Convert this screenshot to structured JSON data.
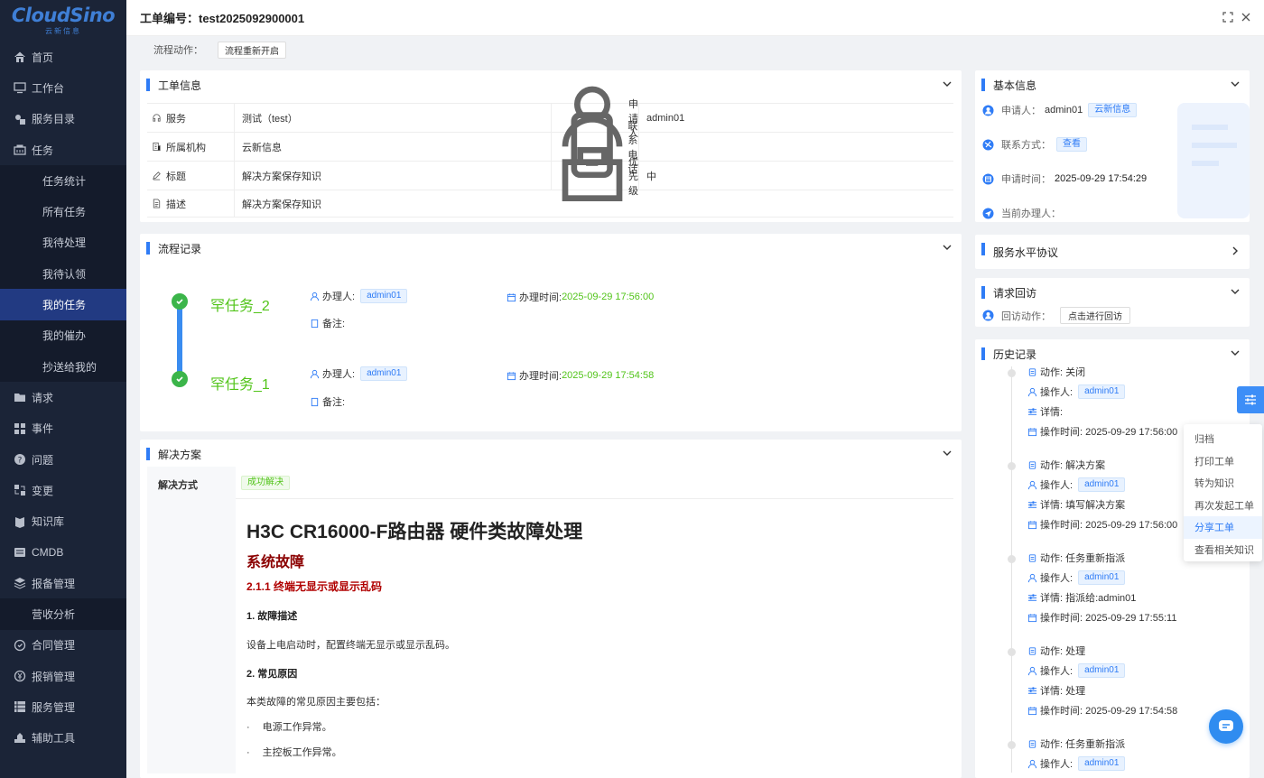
{
  "app": {
    "logo_text": "CloudSino",
    "logo_sub": "云新信息"
  },
  "sidebar": {
    "items": [
      {
        "label": "首页",
        "icon": "home-icon"
      },
      {
        "label": "工作台",
        "icon": "monitor-icon"
      },
      {
        "label": "服务目录",
        "icon": "catalog-icon"
      },
      {
        "label": "任务",
        "icon": "task-icon"
      },
      {
        "label": "任务统计",
        "sub": true
      },
      {
        "label": "所有任务",
        "sub": true
      },
      {
        "label": "我待处理",
        "sub": true
      },
      {
        "label": "我待认领",
        "sub": true
      },
      {
        "label": "我的任务",
        "sub": true,
        "active": true
      },
      {
        "label": "我的催办",
        "sub": true
      },
      {
        "label": "抄送给我的",
        "sub": true
      },
      {
        "label": "请求",
        "icon": "folder-icon"
      },
      {
        "label": "事件",
        "icon": "grid-icon"
      },
      {
        "label": "问题",
        "icon": "question-icon"
      },
      {
        "label": "变更",
        "icon": "change-icon"
      },
      {
        "label": "知识库",
        "icon": "knowledge-icon"
      },
      {
        "label": "CMDB",
        "icon": "cmdb-icon"
      },
      {
        "label": "报备管理",
        "icon": "layers-icon"
      },
      {
        "label": "营收分析",
        "sub_plain": true
      },
      {
        "label": "合同管理",
        "icon": "contract-icon"
      },
      {
        "label": "报销管理",
        "icon": "money-icon"
      },
      {
        "label": "服务管理",
        "icon": "service-icon"
      },
      {
        "label": "辅助工具",
        "icon": "tool-icon"
      }
    ]
  },
  "header": {
    "title": "工单编号：test2025092900001"
  },
  "action_bar": {
    "label": "流程动作：",
    "button": "流程重新开启"
  },
  "work_order": {
    "title": "工单信息",
    "rows": [
      {
        "label1": "服务",
        "value1": "测试（test）",
        "label2": "申请人",
        "value2": "admin01"
      },
      {
        "label1": "所属机构",
        "value1": "云新信息",
        "label2": "联系电话",
        "value2": ""
      },
      {
        "label1": "标题",
        "value1": "解决方案保存知识",
        "label2": "优先级",
        "value2": "中"
      },
      {
        "label1": "描述",
        "value1": "解决方案保存知识"
      }
    ]
  },
  "process": {
    "title": "流程记录",
    "items": [
      {
        "name": "任务_2",
        "handler_label": "办理人:",
        "handler": "admin01",
        "time_label": "办理时间:",
        "time": "2025-09-29  17:56:00",
        "note_label": "备注:"
      },
      {
        "name": "任务_1",
        "handler_label": "办理人:",
        "handler": "admin01",
        "time_label": "办理时间:",
        "time": "2025-09-29  17:54:58",
        "note_label": "备注:"
      }
    ]
  },
  "solution": {
    "title": "解决方案",
    "method_label": "解决方式",
    "method_tag": "成功解决",
    "h1": "H3C CR16000-F路由器 硬件类故障处理",
    "h2": "系统故障",
    "h3": "2.1.1 终端无显示或显示乱码",
    "s1": "1. 故障描述",
    "p1": "设备上电启动时，配置终端无显示或显示乱码。",
    "s2": "2. 常见原因",
    "p2": "本类故障的常见原因主要包括：",
    "b1": "电源工作异常。",
    "b2": "主控板工作异常。",
    "bullet": "·"
  },
  "basic_info": {
    "title": "基本信息",
    "applicant_label": "申请人：",
    "applicant": "admin01",
    "org_tag": "云新信息",
    "contact_label": "联系方式：",
    "contact_tag": "查看",
    "time_label": "申请时间：",
    "time": "2025-09-29 17:54:29",
    "handler_label": "当前办理人："
  },
  "sla": {
    "title": "服务水平协议"
  },
  "revisit": {
    "title": "请求回访",
    "action_label": "回访动作：",
    "button": "点击进行回访"
  },
  "history": {
    "title": "历史记录",
    "items": [
      {
        "action": "动作: 关闭",
        "operator_label": "操作人:",
        "operator": "admin01",
        "detail": "详情:",
        "time": "操作时间: 2025-09-29 17:56:00"
      },
      {
        "action": "动作: 解决方案",
        "operator_label": "操作人:",
        "operator": "admin01",
        "detail": "详情: 填写解决方案",
        "time": "操作时间: 2025-09-29 17:56:00"
      },
      {
        "action": "动作: 任务重新指派",
        "operator_label": "操作人:",
        "operator": "admin01",
        "detail": "详情: 指派给:admin01",
        "time": "操作时间: 2025-09-29 17:55:11"
      },
      {
        "action": "动作: 处理",
        "operator_label": "操作人:",
        "operator": "admin01",
        "detail": "详情: 处理",
        "time": "操作时间: 2025-09-29 17:54:58"
      },
      {
        "action": "动作: 任务重新指派",
        "operator_label": "操作人:",
        "operator": "admin01"
      }
    ]
  },
  "float_menu": {
    "items": [
      "归档",
      "打印工单",
      "转为知识",
      "再次发起工单",
      "分享工单",
      "查看相关知识"
    ],
    "active_index": 4
  },
  "colors": {
    "accent": "#2f7cf6",
    "sidebar_bg": "#1b2437",
    "success": "#52c41a"
  }
}
